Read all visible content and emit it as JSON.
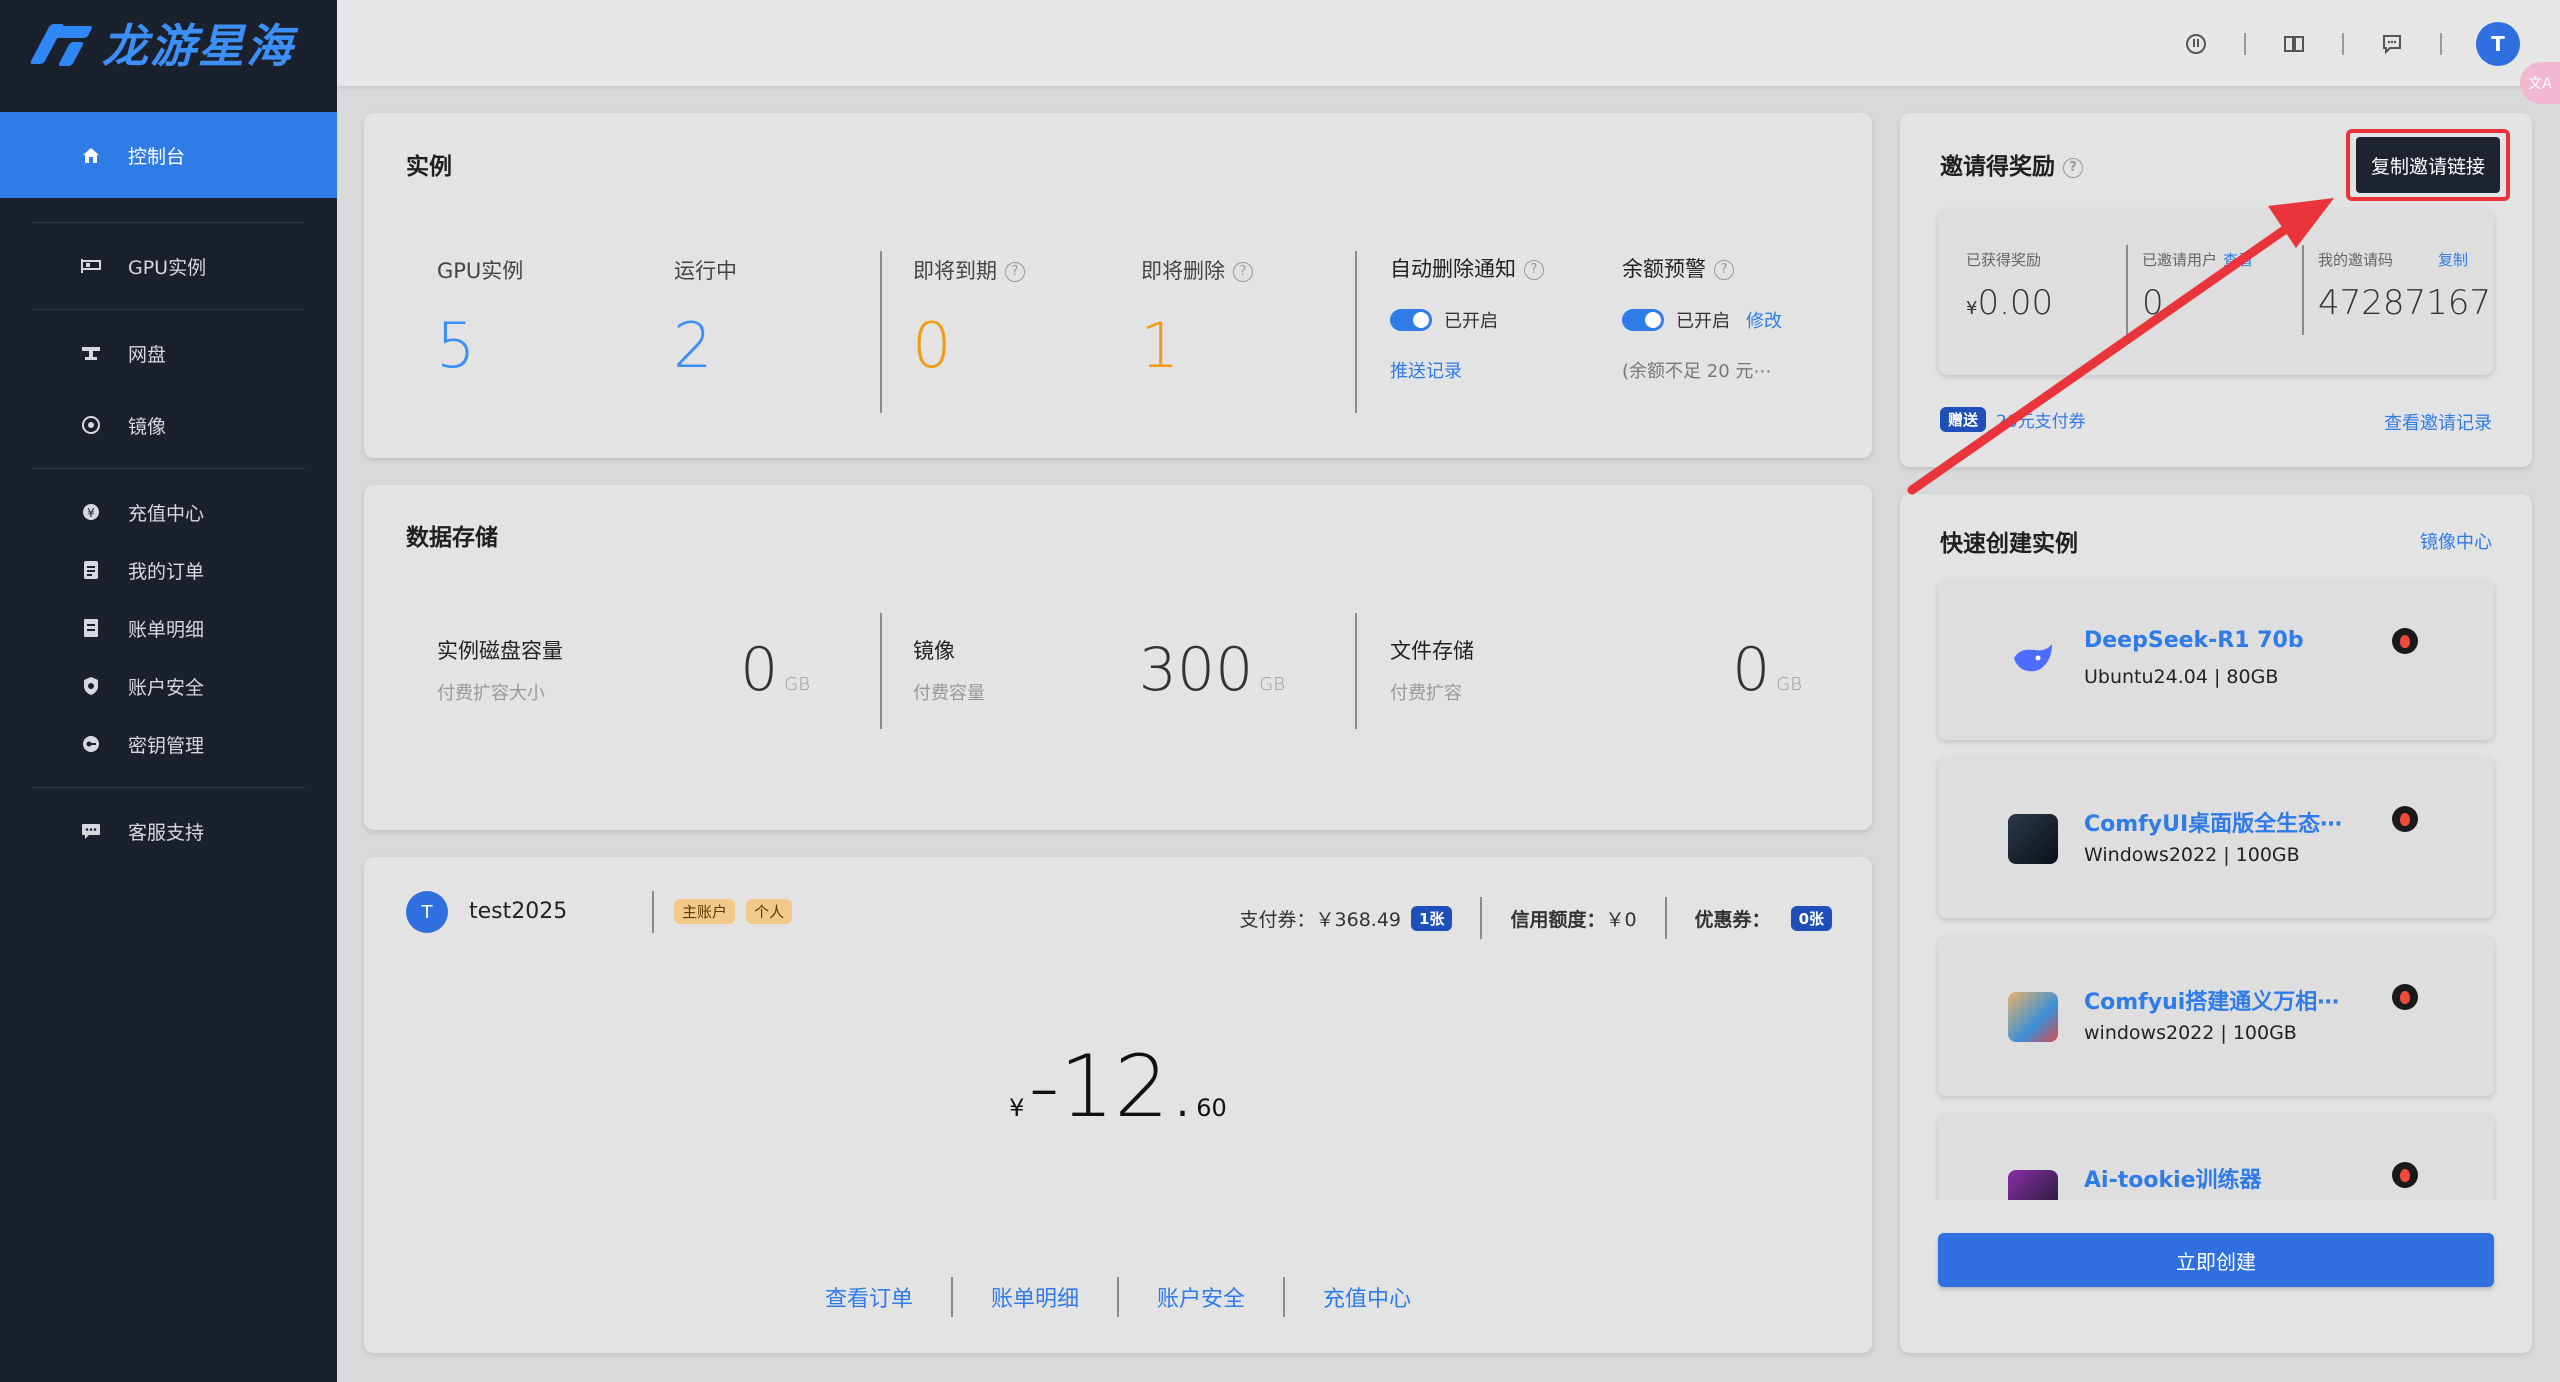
{
  "brand": {
    "logo_text": "龙游星海"
  },
  "sidebar": {
    "items": [
      {
        "label": "控制台",
        "icon": "home-icon",
        "active": true
      },
      {
        "label": "GPU实例",
        "icon": "gpu-icon"
      },
      {
        "label": "网盘",
        "icon": "disk-icon"
      },
      {
        "label": "镜像",
        "icon": "image-icon"
      },
      {
        "label": "充值中心",
        "icon": "recharge-icon"
      },
      {
        "label": "我的订单",
        "icon": "order-icon"
      },
      {
        "label": "账单明细",
        "icon": "bill-icon"
      },
      {
        "label": "账户安全",
        "icon": "shield-icon"
      },
      {
        "label": "密钥管理",
        "icon": "key-icon"
      },
      {
        "label": "客服支持",
        "icon": "chat-icon"
      }
    ]
  },
  "header": {
    "avatar_letter": "T",
    "translate_label": "文A"
  },
  "instances": {
    "title": "实例",
    "gpu_label": "GPU实例",
    "gpu_value": "5",
    "running_label": "运行中",
    "running_value": "2",
    "expiring_label": "即将到期",
    "expiring_value": "0",
    "deleting_label": "即将删除",
    "deleting_value": "1",
    "auto_delete_label": "自动删除通知",
    "auto_delete_state": "已开启",
    "push_record": "推送记录",
    "balance_warn_label": "余额预警",
    "balance_warn_state": "已开启",
    "modify": "修改",
    "balance_note": "(余额不足 20 元⋯"
  },
  "storage": {
    "title": "数据存储",
    "disk_label": "实例磁盘容量",
    "disk_sub": "付费扩容大小",
    "disk_value": "0",
    "disk_unit": "GB",
    "image_label": "镜像",
    "image_sub": "付费容量",
    "image_value": "300",
    "image_unit": "GB",
    "file_label": "文件存储",
    "file_sub": "付费扩容",
    "file_value": "0",
    "file_unit": "GB"
  },
  "account": {
    "avatar_letter": "T",
    "username": "test2025",
    "badge_main": "主账户",
    "badge_personal": "个人",
    "coupon_label": "支付券：",
    "coupon_value": "￥368.49",
    "coupon_count": "1张",
    "credit_label": "信用额度：",
    "credit_value": "￥0",
    "discount_label": "优惠券：",
    "discount_count": "0张",
    "balance_symbol": "¥",
    "balance_int": "-12.",
    "balance_dec": "60",
    "links": [
      "查看订单",
      "账单明细",
      "账户安全",
      "充值中心"
    ]
  },
  "invite": {
    "title": "邀请得奖励",
    "copy_button": "复制邀请链接",
    "reward_label": "已获得奖励",
    "reward_symbol": "¥",
    "reward_value": "0.00",
    "invited_label": "已邀请用户",
    "invited_view": "查看",
    "invited_value": "0",
    "code_label": "我的邀请码",
    "code_copy": "复制",
    "code_value": "47287167",
    "gift_badge": "赠送",
    "gift_text": "20元支付券",
    "record_link": "查看邀请记录"
  },
  "quick_create": {
    "title": "快速创建实例",
    "mirror_link": "镜像中心",
    "items": [
      {
        "name": "DeepSeek-R1 70b",
        "sub": "Ubuntu24.04  |  80GB"
      },
      {
        "name": "ComfyUI桌面版全生态⋯",
        "sub": "Windows2022  |  100GB"
      },
      {
        "name": "Comfyui搭建通义万相⋯",
        "sub": "windows2022  |  100GB"
      },
      {
        "name": "Ai-tookie训练器",
        "sub": ""
      }
    ],
    "create_button": "立即创建"
  },
  "colors": {
    "primary": "#2f7be8",
    "sidebar": "#1b212c",
    "orange": "#f39c12",
    "annotation": "#e8343a"
  }
}
